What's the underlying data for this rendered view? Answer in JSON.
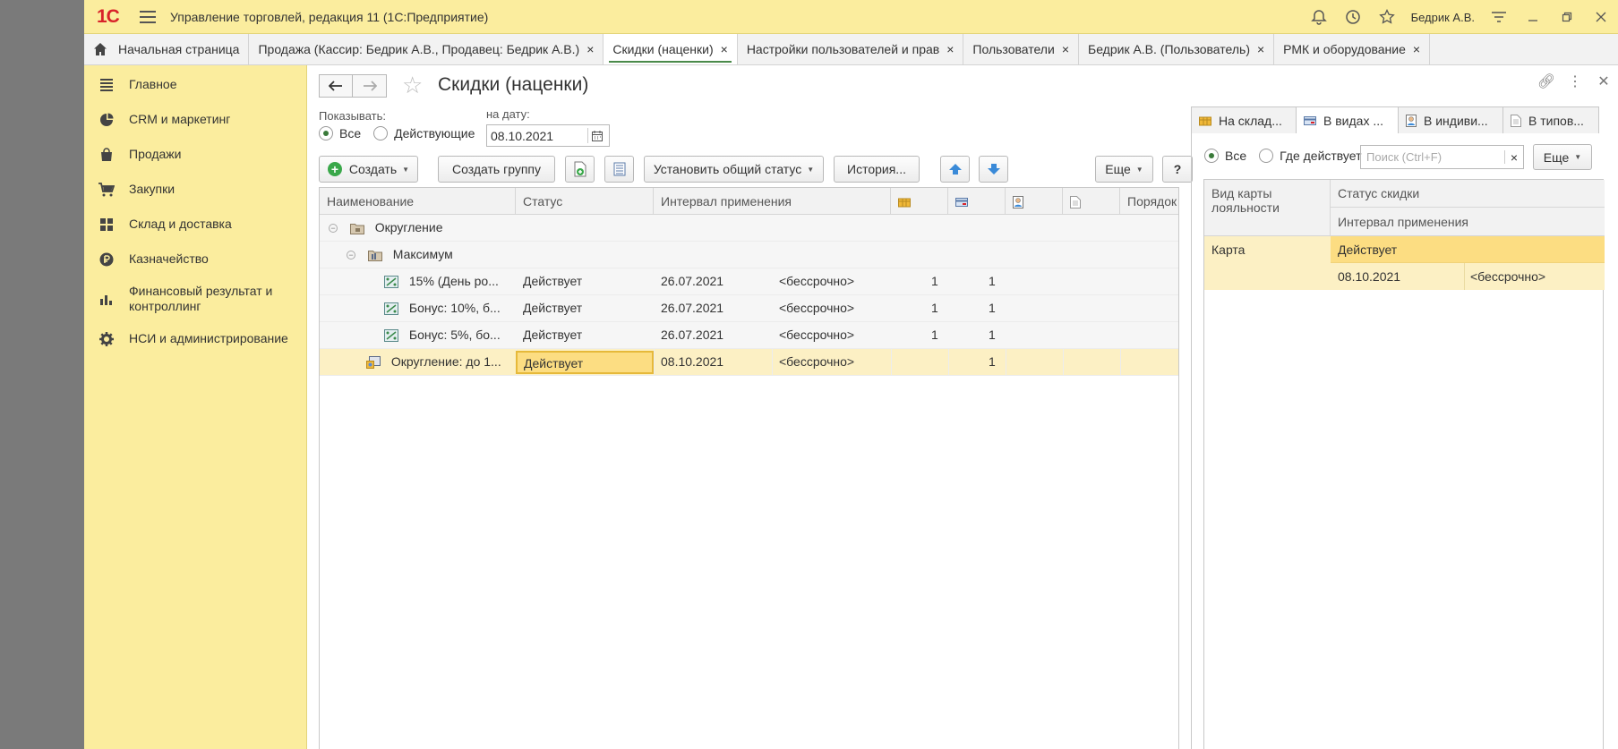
{
  "app": {
    "logo": "1С",
    "title": "Управление торговлей, редакция 11  (1С:Предприятие)",
    "user": "Бедрик А.В."
  },
  "tabs": [
    {
      "label": "Начальная страница",
      "closable": false
    },
    {
      "label": "Продажа (Кассир: Бедрик А.В., Продавец: Бедрик А.В.)",
      "closable": true
    },
    {
      "label": "Скидки (наценки)",
      "closable": true,
      "active": true
    },
    {
      "label": "Настройки пользователей и прав",
      "closable": true
    },
    {
      "label": "Пользователи",
      "closable": true
    },
    {
      "label": "Бедрик А.В. (Пользователь)",
      "closable": true
    },
    {
      "label": "РМК и оборудование",
      "closable": true
    }
  ],
  "tab_close": "×",
  "sidebar": {
    "items": [
      {
        "label": "Главное",
        "icon": "list-icon"
      },
      {
        "label": "CRM и маркетинг",
        "icon": "pie-chart-icon"
      },
      {
        "label": "Продажи",
        "icon": "shopping-bag-icon"
      },
      {
        "label": "Закупки",
        "icon": "cart-icon"
      },
      {
        "label": "Склад и доставка",
        "icon": "warehouse-grid-icon"
      },
      {
        "label": "Казначейство",
        "icon": "ruble-coin-icon"
      },
      {
        "label": "Финансовый результат и контроллинг",
        "icon": "bar-chart-icon"
      },
      {
        "label": "НСИ и администрирование",
        "icon": "gear-icon"
      }
    ]
  },
  "page": {
    "title": "Скидки (наценки)",
    "show_label": "Показывать:",
    "show_all": "Все",
    "show_active": "Действующие",
    "date_label": "на дату:",
    "date_value": "08.10.2021"
  },
  "toolbar": {
    "create": "Создать",
    "create_group": "Создать группу",
    "set_status": "Установить общий статус",
    "history": "История...",
    "more": "Еще",
    "help": "?"
  },
  "table": {
    "columns": {
      "name": "Наименование",
      "status": "Статус",
      "interval": "Интервал применения",
      "order": "Порядок"
    },
    "rows": [
      {
        "level": 0,
        "type": "group",
        "name": "Округление"
      },
      {
        "level": 1,
        "type": "group",
        "name": "Максимум"
      },
      {
        "level": 2,
        "type": "item",
        "name": "15% (День ро...",
        "status": "Действует",
        "from": "26.07.2021",
        "to": "<бессрочно>",
        "c1": "1",
        "c2": "1"
      },
      {
        "level": 2,
        "type": "item",
        "name": "Бонус: 10%, б...",
        "status": "Действует",
        "from": "26.07.2021",
        "to": "<бессрочно>",
        "c1": "1",
        "c2": "1"
      },
      {
        "level": 2,
        "type": "item",
        "name": "Бонус: 5%, бо...",
        "status": "Действует",
        "from": "26.07.2021",
        "to": "<бессрочно>",
        "c1": "1",
        "c2": "1"
      },
      {
        "level": 1,
        "type": "rounding",
        "name": "Округление: до 1...",
        "status": "Действует",
        "from": "08.10.2021",
        "to": "<бессрочно>",
        "c1": "",
        "c2": "1",
        "selected": true
      }
    ]
  },
  "right_panel": {
    "tabs": [
      "На склад...",
      "В видах ...",
      "В индиви...",
      "В типов..."
    ],
    "filter_all": "Все",
    "filter_where": "Где действует",
    "search_placeholder": "Поиск (Ctrl+F)",
    "search_clear": "×",
    "more": "Еще",
    "col_card_type": "Вид карты лояльности",
    "col_status": "Статус скидки",
    "col_interval": "Интервал применения",
    "row": {
      "card": "Карта",
      "status": "Действует",
      "from": "08.10.2021",
      "to": "<бессрочно>"
    }
  },
  "colors": {
    "accent_yellow": "#fbed9e",
    "selection": "#fcf0c4",
    "logo_red": "#d8232a"
  }
}
